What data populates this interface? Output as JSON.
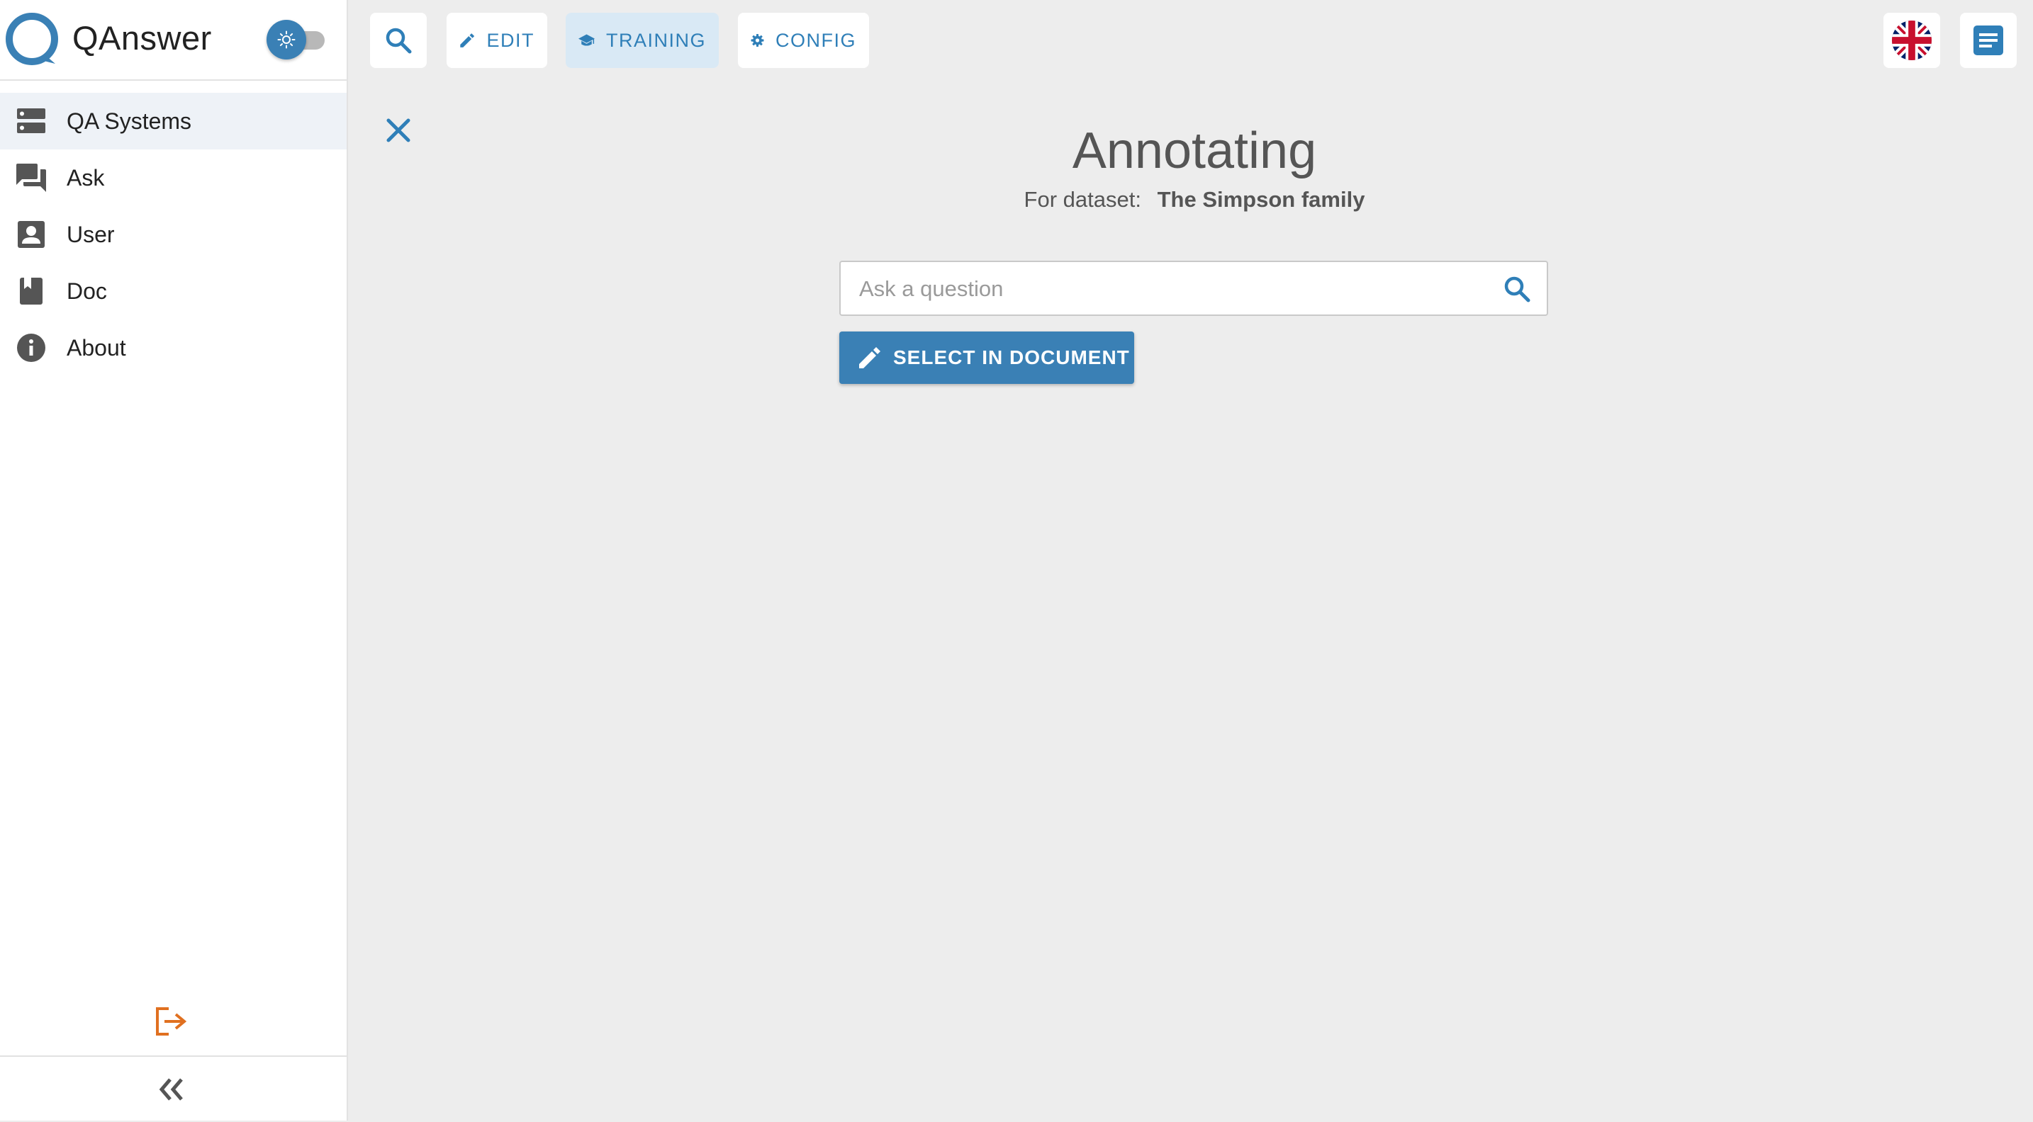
{
  "app": {
    "name": "QAnswer",
    "accent_color": "#3a80b5",
    "toggle_icon": "sun-icon"
  },
  "sidebar": {
    "items": [
      {
        "label": "QA Systems",
        "icon": "server-icon",
        "active": true
      },
      {
        "label": "Ask",
        "icon": "forum-icon",
        "active": false
      },
      {
        "label": "User",
        "icon": "account-box-icon",
        "active": false
      },
      {
        "label": "Doc",
        "icon": "book-icon",
        "active": false
      },
      {
        "label": "About",
        "icon": "info-icon",
        "active": false
      }
    ],
    "logout_icon": "logout-icon",
    "logout_color": "#e07020",
    "collapse_icon": "double-chevron-left-icon"
  },
  "toolbar": {
    "search_icon": "search-icon",
    "edit_label": "EDIT",
    "training_label": "TRAINING",
    "config_label": "CONFIG",
    "active_tab": "TRAINING",
    "language_icon": "uk-flag-icon",
    "document_icon": "document-icon"
  },
  "main": {
    "title": "Annotating",
    "dataset_prefix": "For dataset:",
    "dataset_name": "The Simpson family",
    "search_placeholder": "Ask a question",
    "search_value": "",
    "select_button_label": "SELECT IN DOCUMENT"
  }
}
